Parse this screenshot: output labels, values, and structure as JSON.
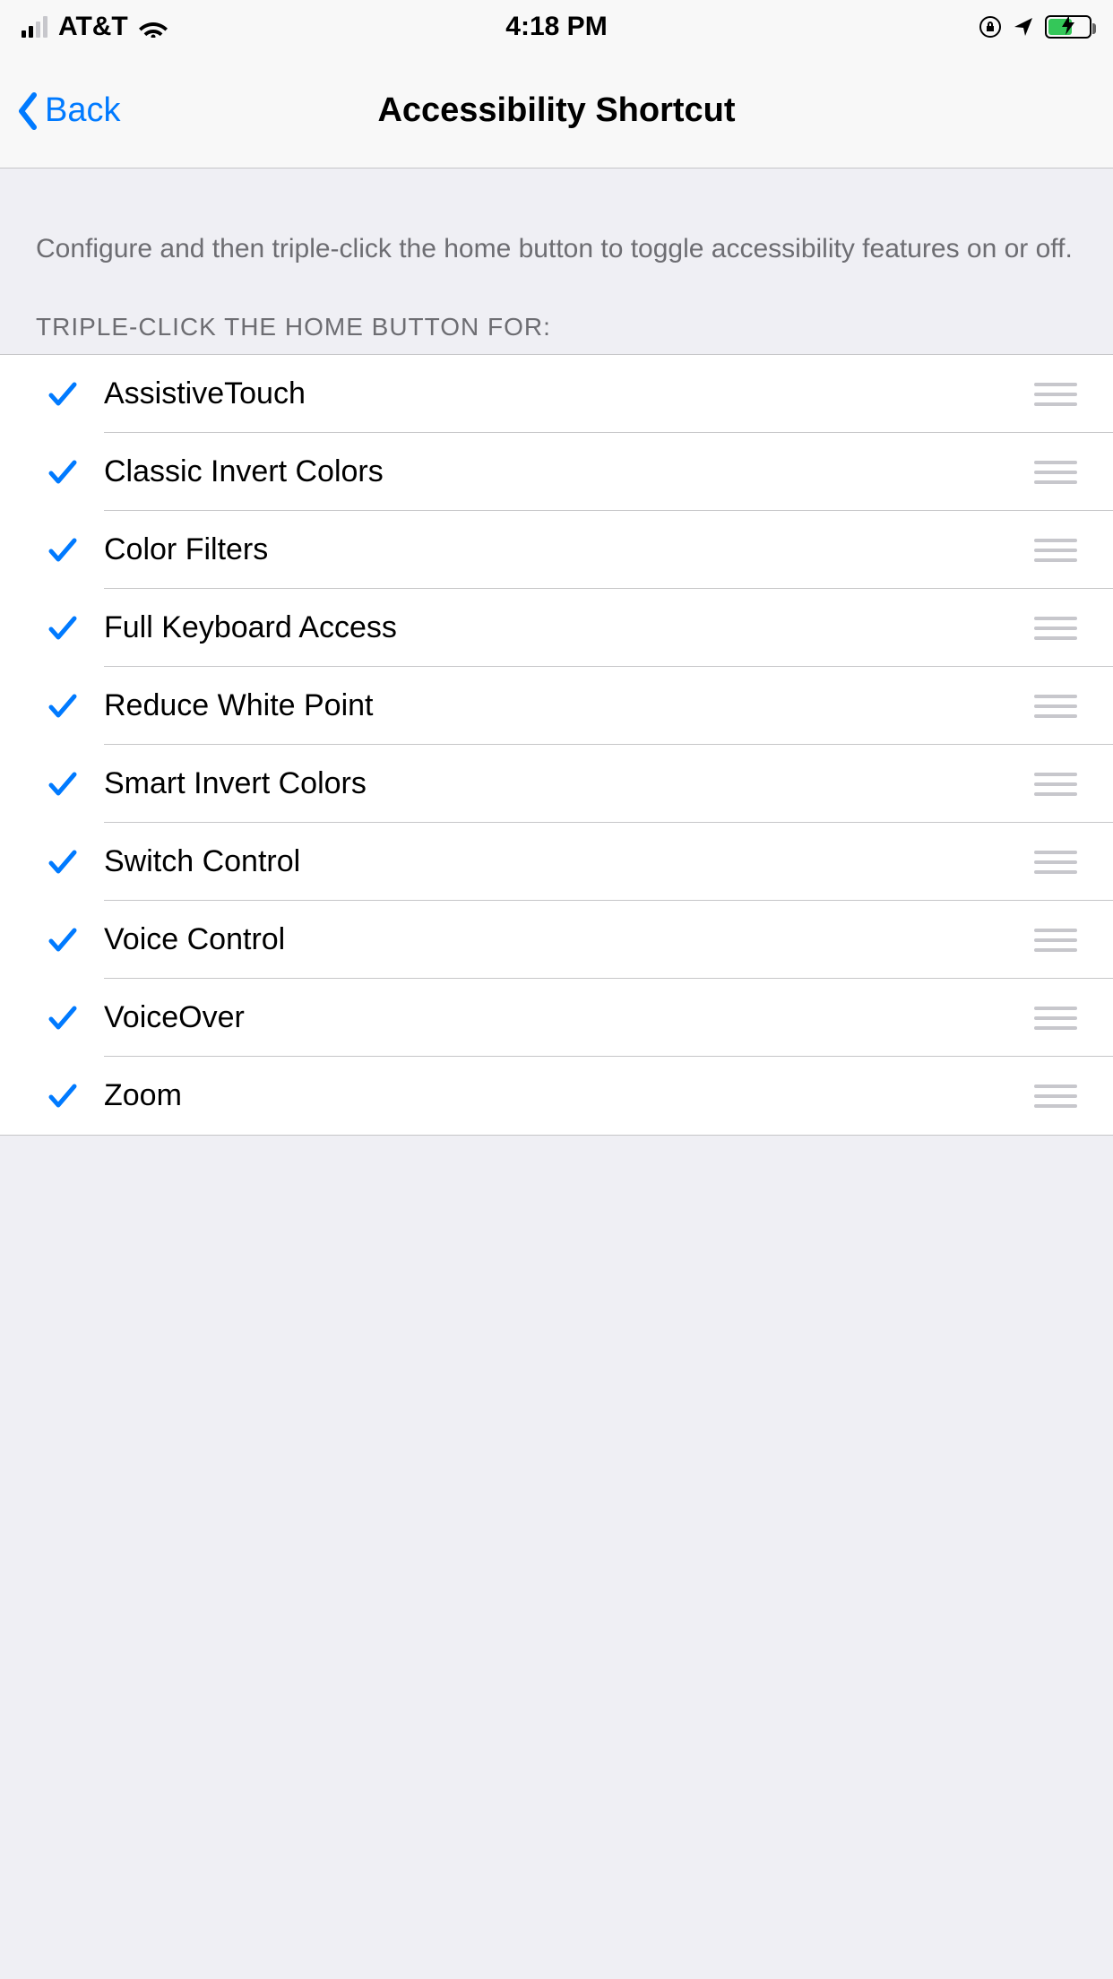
{
  "status": {
    "carrier": "AT&T",
    "time": "4:18 PM"
  },
  "nav": {
    "back_label": "Back",
    "title": "Accessibility Shortcut"
  },
  "section": {
    "description": "Configure and then triple-click the home button to toggle accessibility features on or off.",
    "header": "TRIPLE-CLICK THE HOME BUTTON FOR:"
  },
  "items": [
    {
      "label": "AssistiveTouch",
      "checked": true
    },
    {
      "label": "Classic Invert Colors",
      "checked": true
    },
    {
      "label": "Color Filters",
      "checked": true
    },
    {
      "label": "Full Keyboard Access",
      "checked": true
    },
    {
      "label": "Reduce White Point",
      "checked": true
    },
    {
      "label": "Smart Invert Colors",
      "checked": true
    },
    {
      "label": "Switch Control",
      "checked": true
    },
    {
      "label": "Voice Control",
      "checked": true
    },
    {
      "label": "VoiceOver",
      "checked": true
    },
    {
      "label": "Zoom",
      "checked": true
    }
  ]
}
